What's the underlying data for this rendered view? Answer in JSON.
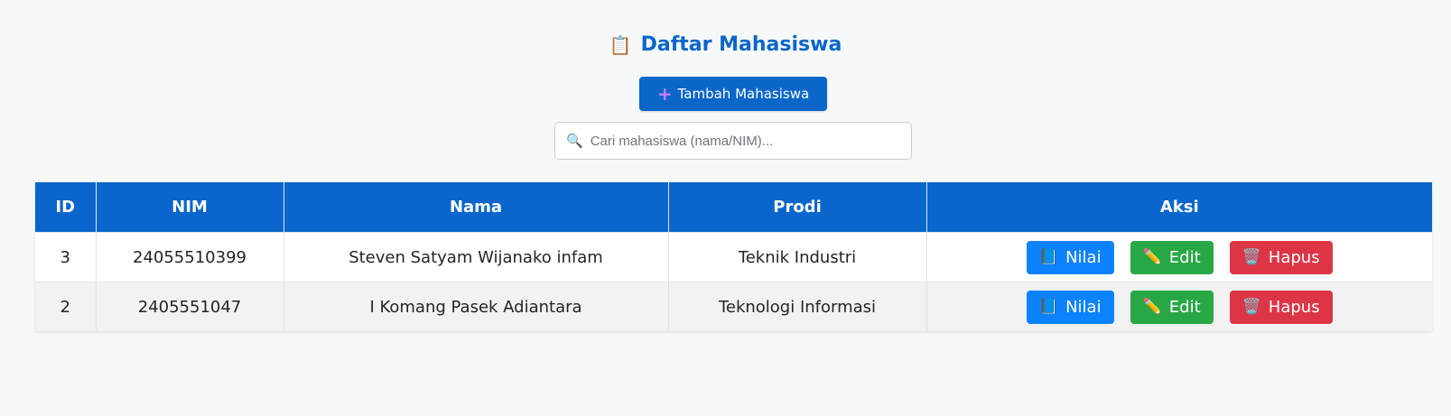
{
  "header": {
    "title": "Daftar Mahasiswa",
    "title_icon": "clipboard-icon",
    "accent": "#0a66c8"
  },
  "add_button": {
    "label": "Tambah Mahasiswa",
    "icon": "plus-icon"
  },
  "search": {
    "placeholder": "Cari mahasiswa (nama/NIM)...",
    "value": "",
    "icon": "search-icon"
  },
  "table": {
    "columns": [
      "ID",
      "NIM",
      "Nama",
      "Prodi",
      "Aksi"
    ],
    "rows": [
      {
        "id": "3",
        "nim": "24055510399",
        "nama": "Steven Satyam Wijanako infam",
        "prodi": "Teknik Industri"
      },
      {
        "id": "2",
        "nim": "2405551047",
        "nama": "I Komang Pasek Adiantara",
        "prodi": "Teknologi Informasi"
      }
    ],
    "actions": {
      "nilai": "Nilai",
      "edit": "Edit",
      "hapus": "Hapus"
    },
    "colors": {
      "header": "#0a66cc",
      "nilai": "#0d82ff",
      "edit": "#28a745",
      "hapus": "#dc3545"
    }
  }
}
